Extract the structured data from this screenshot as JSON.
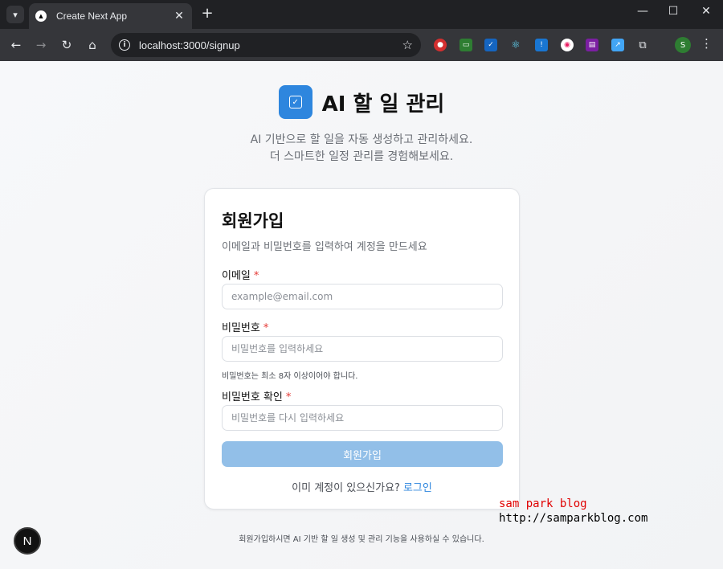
{
  "browser": {
    "tab_title": "Create Next App",
    "url": "localhost:3000/signup",
    "profile_initial": "S"
  },
  "brand": {
    "title": "AI 할 일 관리",
    "subtitle_line1": "AI 기반으로 할 일을 자동 생성하고 관리하세요.",
    "subtitle_line2": "더 스마트한 일정 관리를 경험해보세요.",
    "accent_color": "#2e86de"
  },
  "signup": {
    "title": "회원가입",
    "description": "이메일과 비밀번호를 입력하여 계정을 만드세요",
    "email_label": "이메일",
    "email_placeholder": "example@email.com",
    "password_label": "비밀번호",
    "password_placeholder": "비밀번호를 입력하세요",
    "password_hint": "비밀번호는 최소 8자 이상이어야 합니다.",
    "confirm_label": "비밀번호 확인",
    "confirm_placeholder": "비밀번호를 다시 입력하세요",
    "required_mark": "*",
    "submit_label": "회원가입",
    "login_prompt": "이미 계정이 있으신가요?",
    "login_link": "로그인"
  },
  "footer": {
    "text": "회원가입하시면 AI 기반 할 일 생성 및 관리 기능을 사용하실 수 있습니다."
  },
  "watermark": {
    "line1": "sam park blog",
    "line2": "http://samparkblog.com"
  },
  "next_badge": "N"
}
